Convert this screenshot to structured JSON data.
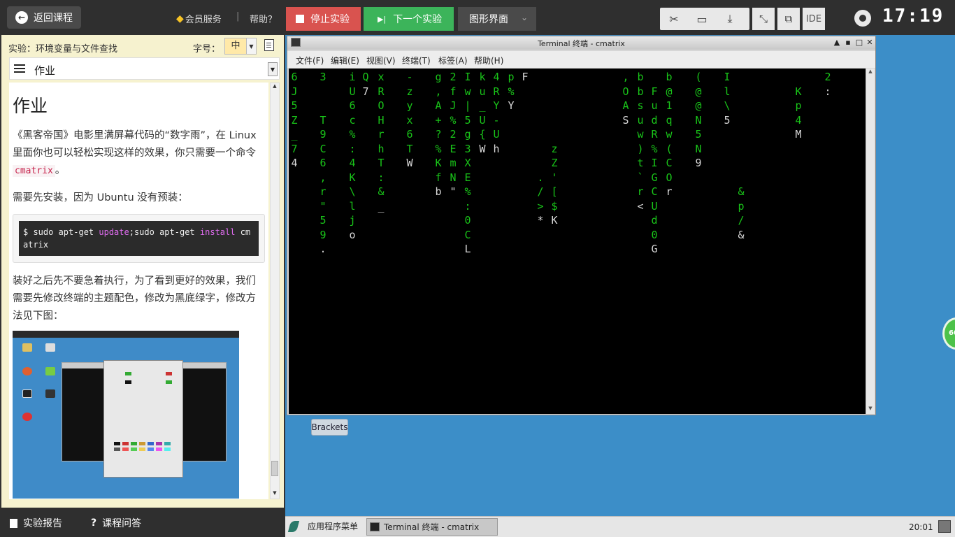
{
  "topbar": {
    "back_label": "返回课程",
    "member_label": "会员服务",
    "separator": "|",
    "help_label": "帮助？",
    "stop_label": "停止实验",
    "next_label": "下一个实验",
    "mode_label": "图形界面",
    "ide_label": "IDE",
    "clock": "17:19"
  },
  "left": {
    "lab_title": "实验：环境变量与文件查找",
    "font_size_label": "字号：",
    "font_size_value": "中",
    "section_label": "作业",
    "content": {
      "heading": "作业",
      "p1_text": "《黑客帝国》电影里满屏幕代码的“数字雨”，在 Linux 里面你也可以轻松实现这样的效果，你只需要一个命令 ",
      "p1_code": "cmatrix",
      "p1_end": "。",
      "p2": "需要先安装，因为 Ubuntu 没有预装：",
      "code_prompt": "$ sudo apt-get ",
      "code_kw1": "update",
      "code_mid": ";sudo apt-get ",
      "code_kw2": "install",
      "code_tail": " cmatrix",
      "p3": "装好之后先不要急着执行，为了看到更好的效果，我们需要先修改终端的主题配色，修改为黑底绿字，修改方法见下图："
    },
    "tabs": {
      "report": "实验报告",
      "qa": "课程问答"
    }
  },
  "terminal": {
    "title": "Terminal 终端 - cmatrix",
    "menu": [
      "文件(F)",
      "编辑(E)",
      "视图(V)",
      "终端(T)",
      "标签(A)",
      "帮助(H)"
    ],
    "columns": [
      "6\nJ\n5\nZ\n_\n7\n4",
      "3\n\n\nT\n9\nC\n6\n,\nr\n\"\n5\n9\n.",
      "i\nU\n6\nc\n%\n:\n4\nK\n\\\nl\nj\no",
      "Q\n7",
      "x\nR\nO\nH\nr\nh\nT\n:\n&\n_",
      "-\nz\ny\nx\n6\nT\nW",
      "g\n,\nA\n+\n?\n%\nK\nf\nb",
      "2\nf\nJ\n%\n2\nE\nm\nN\n\"",
      "I\nw\n|\n5\ng\n3\nX\nE\n%\n:\n0\nC\nL",
      "k\nu\n_\nU\n{\nW",
      "4\nR\nY\n-\nU\nh",
      "p\n%\nY",
      "F",
      "\n\n\n\n\n\n\n.\n/\n>\n*",
      "\n\n\n\n\nz\nZ\n'\n[\n$\nK",
      ",\nO\nA\nS",
      "b\nb\ns\nu\nw\n)\nt\n`\nr\n<",
      "\nF\nu\nd\nR\n%\nI\nG\nC\nU\nd\n0\nG",
      "b\n@\n1\nq\nw\n(\nC\nO\nr",
      "(\n@\n@\nN\n5\nN\n9",
      "I\nl\n\\\n5",
      "\n\n\n\n\n\n\n\n&\np\n/\n&",
      "\nK\np\n4\nM",
      "2\n:"
    ]
  },
  "desktop": {
    "brackets_label": "Brackets",
    "badge": "60"
  },
  "taskbar": {
    "start_label": "应用程序菜单",
    "task_label": "Terminal 终端 - cmatrix",
    "time": "20:01"
  }
}
